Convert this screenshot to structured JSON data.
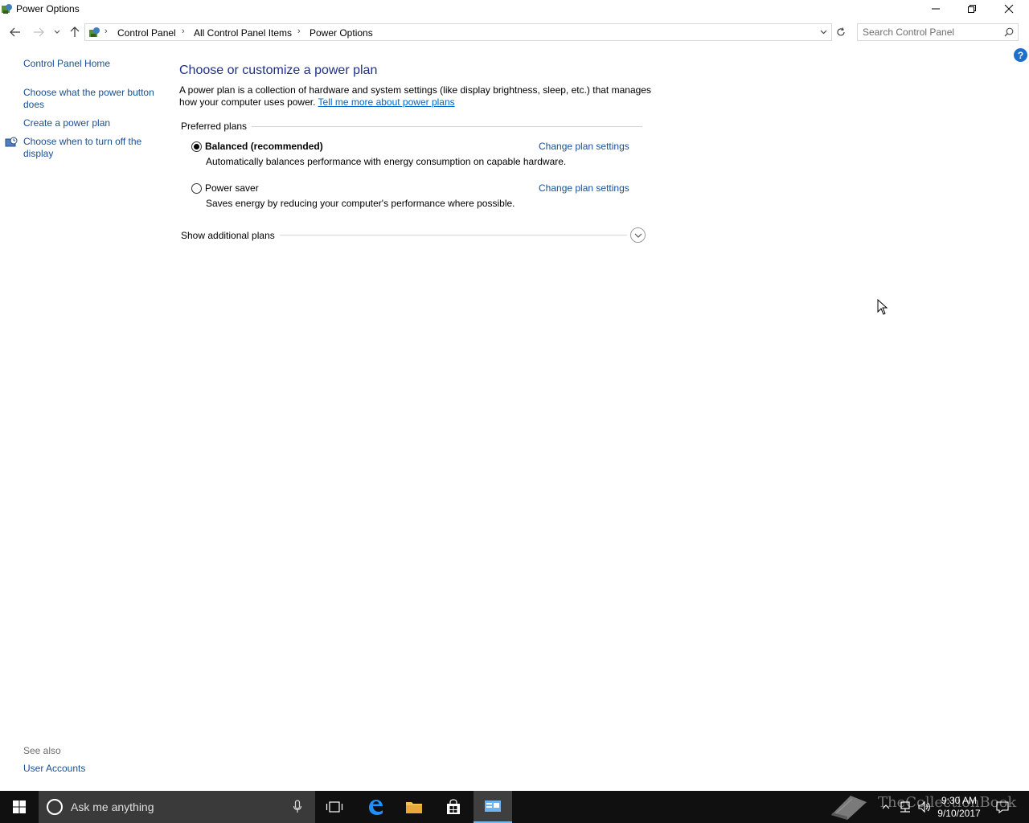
{
  "window": {
    "title": "Power Options"
  },
  "address": {
    "crumbs": [
      "Control Panel",
      "All Control Panel Items",
      "Power Options"
    ],
    "search_placeholder": "Search Control Panel"
  },
  "left_pane": {
    "home": "Control Panel Home",
    "links": [
      "Choose what the power button does",
      "Create a power plan",
      "Choose when to turn off the display"
    ],
    "see_also_label": "See also",
    "see_also_links": [
      "User Accounts"
    ]
  },
  "main": {
    "title": "Choose or customize a power plan",
    "description": "A power plan is a collection of hardware and system settings (like display brightness, sleep, etc.) that manages how your computer uses power.",
    "description_link": "Tell me more about power plans",
    "preferred_label": "Preferred plans",
    "plans": [
      {
        "name": "Balanced (recommended)",
        "selected": true,
        "description": "Automatically balances performance with energy consumption on capable hardware.",
        "link": "Change plan settings"
      },
      {
        "name": "Power saver",
        "selected": false,
        "description": "Saves energy by reducing your computer's performance where possible.",
        "link": "Change plan settings"
      }
    ],
    "additional_label": "Show additional plans"
  },
  "taskbar": {
    "search_text": "Ask me anything",
    "time": "9:30 AM",
    "date": "9/10/2017",
    "watermark": "TheCollectionBook"
  },
  "colors": {
    "link": "#1a4f93",
    "title": "#1e3287",
    "taskbar": "#101010",
    "accent": "#76b9ed"
  }
}
